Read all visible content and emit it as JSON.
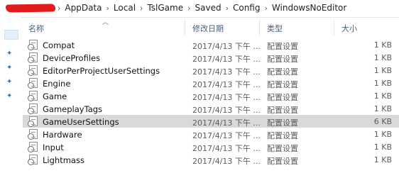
{
  "breadcrumb": {
    "separator": "›",
    "items": [
      "AppData",
      "Local",
      "TslGame",
      "Saved",
      "Config",
      "WindowsNoEditor"
    ]
  },
  "columns": {
    "name": "名称",
    "date": "修改日期",
    "type": "类型",
    "size": "大小"
  },
  "files": [
    {
      "name": "Compat",
      "date": "2017/4/13 下午 ...",
      "type": "配置设置",
      "size": "1 KB"
    },
    {
      "name": "DeviceProfiles",
      "date": "2017/4/13 下午 ...",
      "type": "配置设置",
      "size": "1 KB"
    },
    {
      "name": "EditorPerProjectUserSettings",
      "date": "2017/4/13 下午 ...",
      "type": "配置设置",
      "size": "1 KB"
    },
    {
      "name": "Engine",
      "date": "2017/4/13 下午 ...",
      "type": "配置设置",
      "size": "1 KB"
    },
    {
      "name": "Game",
      "date": "2017/4/13 下午 ...",
      "type": "配置设置",
      "size": "1 KB"
    },
    {
      "name": "GameplayTags",
      "date": "2017/4/13 下午 ...",
      "type": "配置设置",
      "size": "1 KB"
    },
    {
      "name": "GameUserSettings",
      "date": "2017/4/13 下午 ...",
      "type": "配置设置",
      "size": "6 KB",
      "selected": true
    },
    {
      "name": "Hardware",
      "date": "2017/4/13 下午 ...",
      "type": "配置设置",
      "size": "1 KB"
    },
    {
      "name": "Input",
      "date": "2017/4/13 下午 ...",
      "type": "配置设置",
      "size": "1 KB"
    },
    {
      "name": "Lightmass",
      "date": "2017/4/13 下午 ...",
      "type": "配置设置",
      "size": "1 KB"
    }
  ],
  "colors": {
    "selected_row": "#d9d9d9",
    "redaction": "#e21b1b",
    "pin": "#3b6fb6"
  },
  "icons": {
    "file": "config-file-icon",
    "pin": "pin-icon",
    "sort": "sort-up-caret-icon"
  }
}
